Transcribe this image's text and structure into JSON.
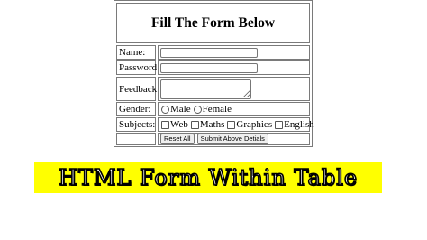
{
  "form": {
    "title": "Fill The Form Below",
    "name_label": "Name:",
    "name_value": "",
    "password_label": "Password:",
    "password_value": "",
    "feedback_label": "Feedback:",
    "feedback_value": "",
    "gender_label": "Gender:",
    "gender_options": [
      "Male",
      "Female"
    ],
    "subjects_label": "Subjects:",
    "subject_options": [
      "Web",
      "Maths",
      "Graphics",
      "English"
    ],
    "reset_label": "Reset All",
    "submit_label": "Submit Above Detials"
  },
  "banner": {
    "text": "HTML Form Within Table",
    "background": "#ffff00"
  }
}
